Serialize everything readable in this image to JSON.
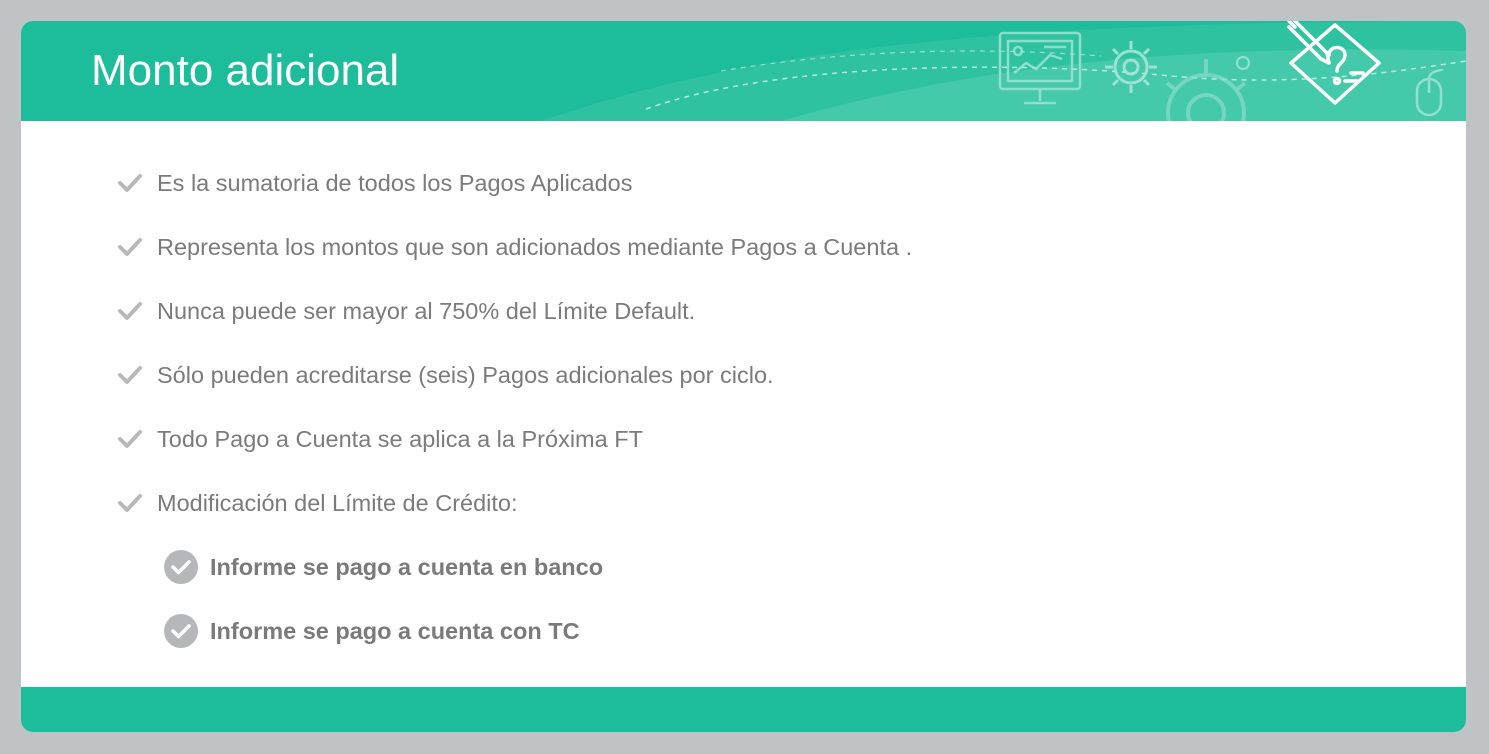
{
  "slide": {
    "title": "Monto adicional",
    "accent_color": "#1dbc9a",
    "bullets": [
      {
        "text": "Es la sumatoria de todos los Pagos Aplicados",
        "icon": "check-icon"
      },
      {
        "text": "Representa los montos que son adicionados mediante Pagos a Cuenta .",
        "icon": "check-icon"
      },
      {
        "text": "Nunca puede ser mayor al 750% del Límite Default.",
        "icon": "check-icon"
      },
      {
        "text": "Sólo pueden acreditarse (seis) Pagos adicionales por ciclo.",
        "icon": "check-icon"
      },
      {
        "text": "Todo Pago a Cuenta se aplica a la Próxima FT",
        "icon": "check-icon"
      },
      {
        "text": "Modificación del Límite de Crédito:",
        "icon": "check-icon"
      }
    ],
    "sub_bullets": [
      {
        "text": "Informe se pago a cuenta en banco",
        "icon": "circle-check-icon"
      },
      {
        "text": "Informe se pago a cuenta con TC",
        "icon": "circle-check-icon"
      }
    ],
    "header_icons": [
      "presentation-board-icon",
      "gear-icon",
      "large-gear-icon",
      "pencil-document-icon",
      "mouse-icon"
    ]
  }
}
